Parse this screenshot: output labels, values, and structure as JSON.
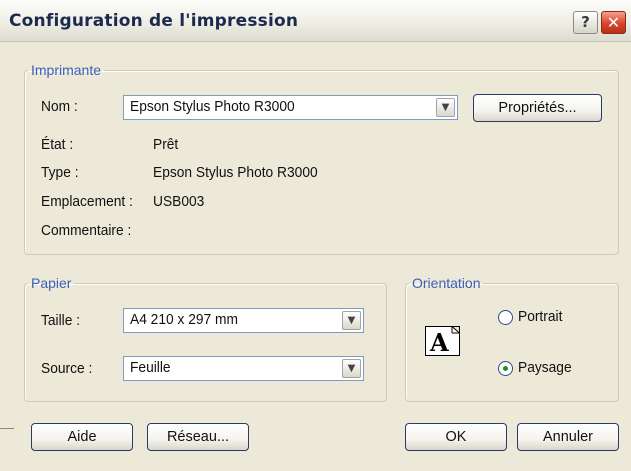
{
  "window": {
    "title": "Configuration de l'impression",
    "help_label": "?",
    "close_label": "✕"
  },
  "printer": {
    "legend": "Imprimante",
    "name_label": "Nom :",
    "name_value": "Epson Stylus Photo R3000",
    "properties_button": "Propriétés...",
    "state_label": "État :",
    "state_value": "Prêt",
    "type_label": "Type :",
    "type_value": "Epson Stylus Photo R3000",
    "location_label": "Emplacement :",
    "location_value": "USB003",
    "comment_label": "Commentaire :",
    "comment_value": ""
  },
  "paper": {
    "legend": "Papier",
    "size_label": "Taille :",
    "size_value": "A4 210 x 297 mm",
    "source_label": "Source :",
    "source_value": "Feuille"
  },
  "orientation": {
    "legend": "Orientation",
    "icon_letter": "A",
    "portrait_label": "Portrait",
    "landscape_label": "Paysage",
    "selected": "Paysage"
  },
  "buttons": {
    "help": "Aide",
    "network": "Réseau...",
    "ok": "OK",
    "cancel": "Annuler"
  },
  "icons": {
    "dropdown": "chevron-down-icon",
    "orientation": "landscape-page-icon"
  }
}
